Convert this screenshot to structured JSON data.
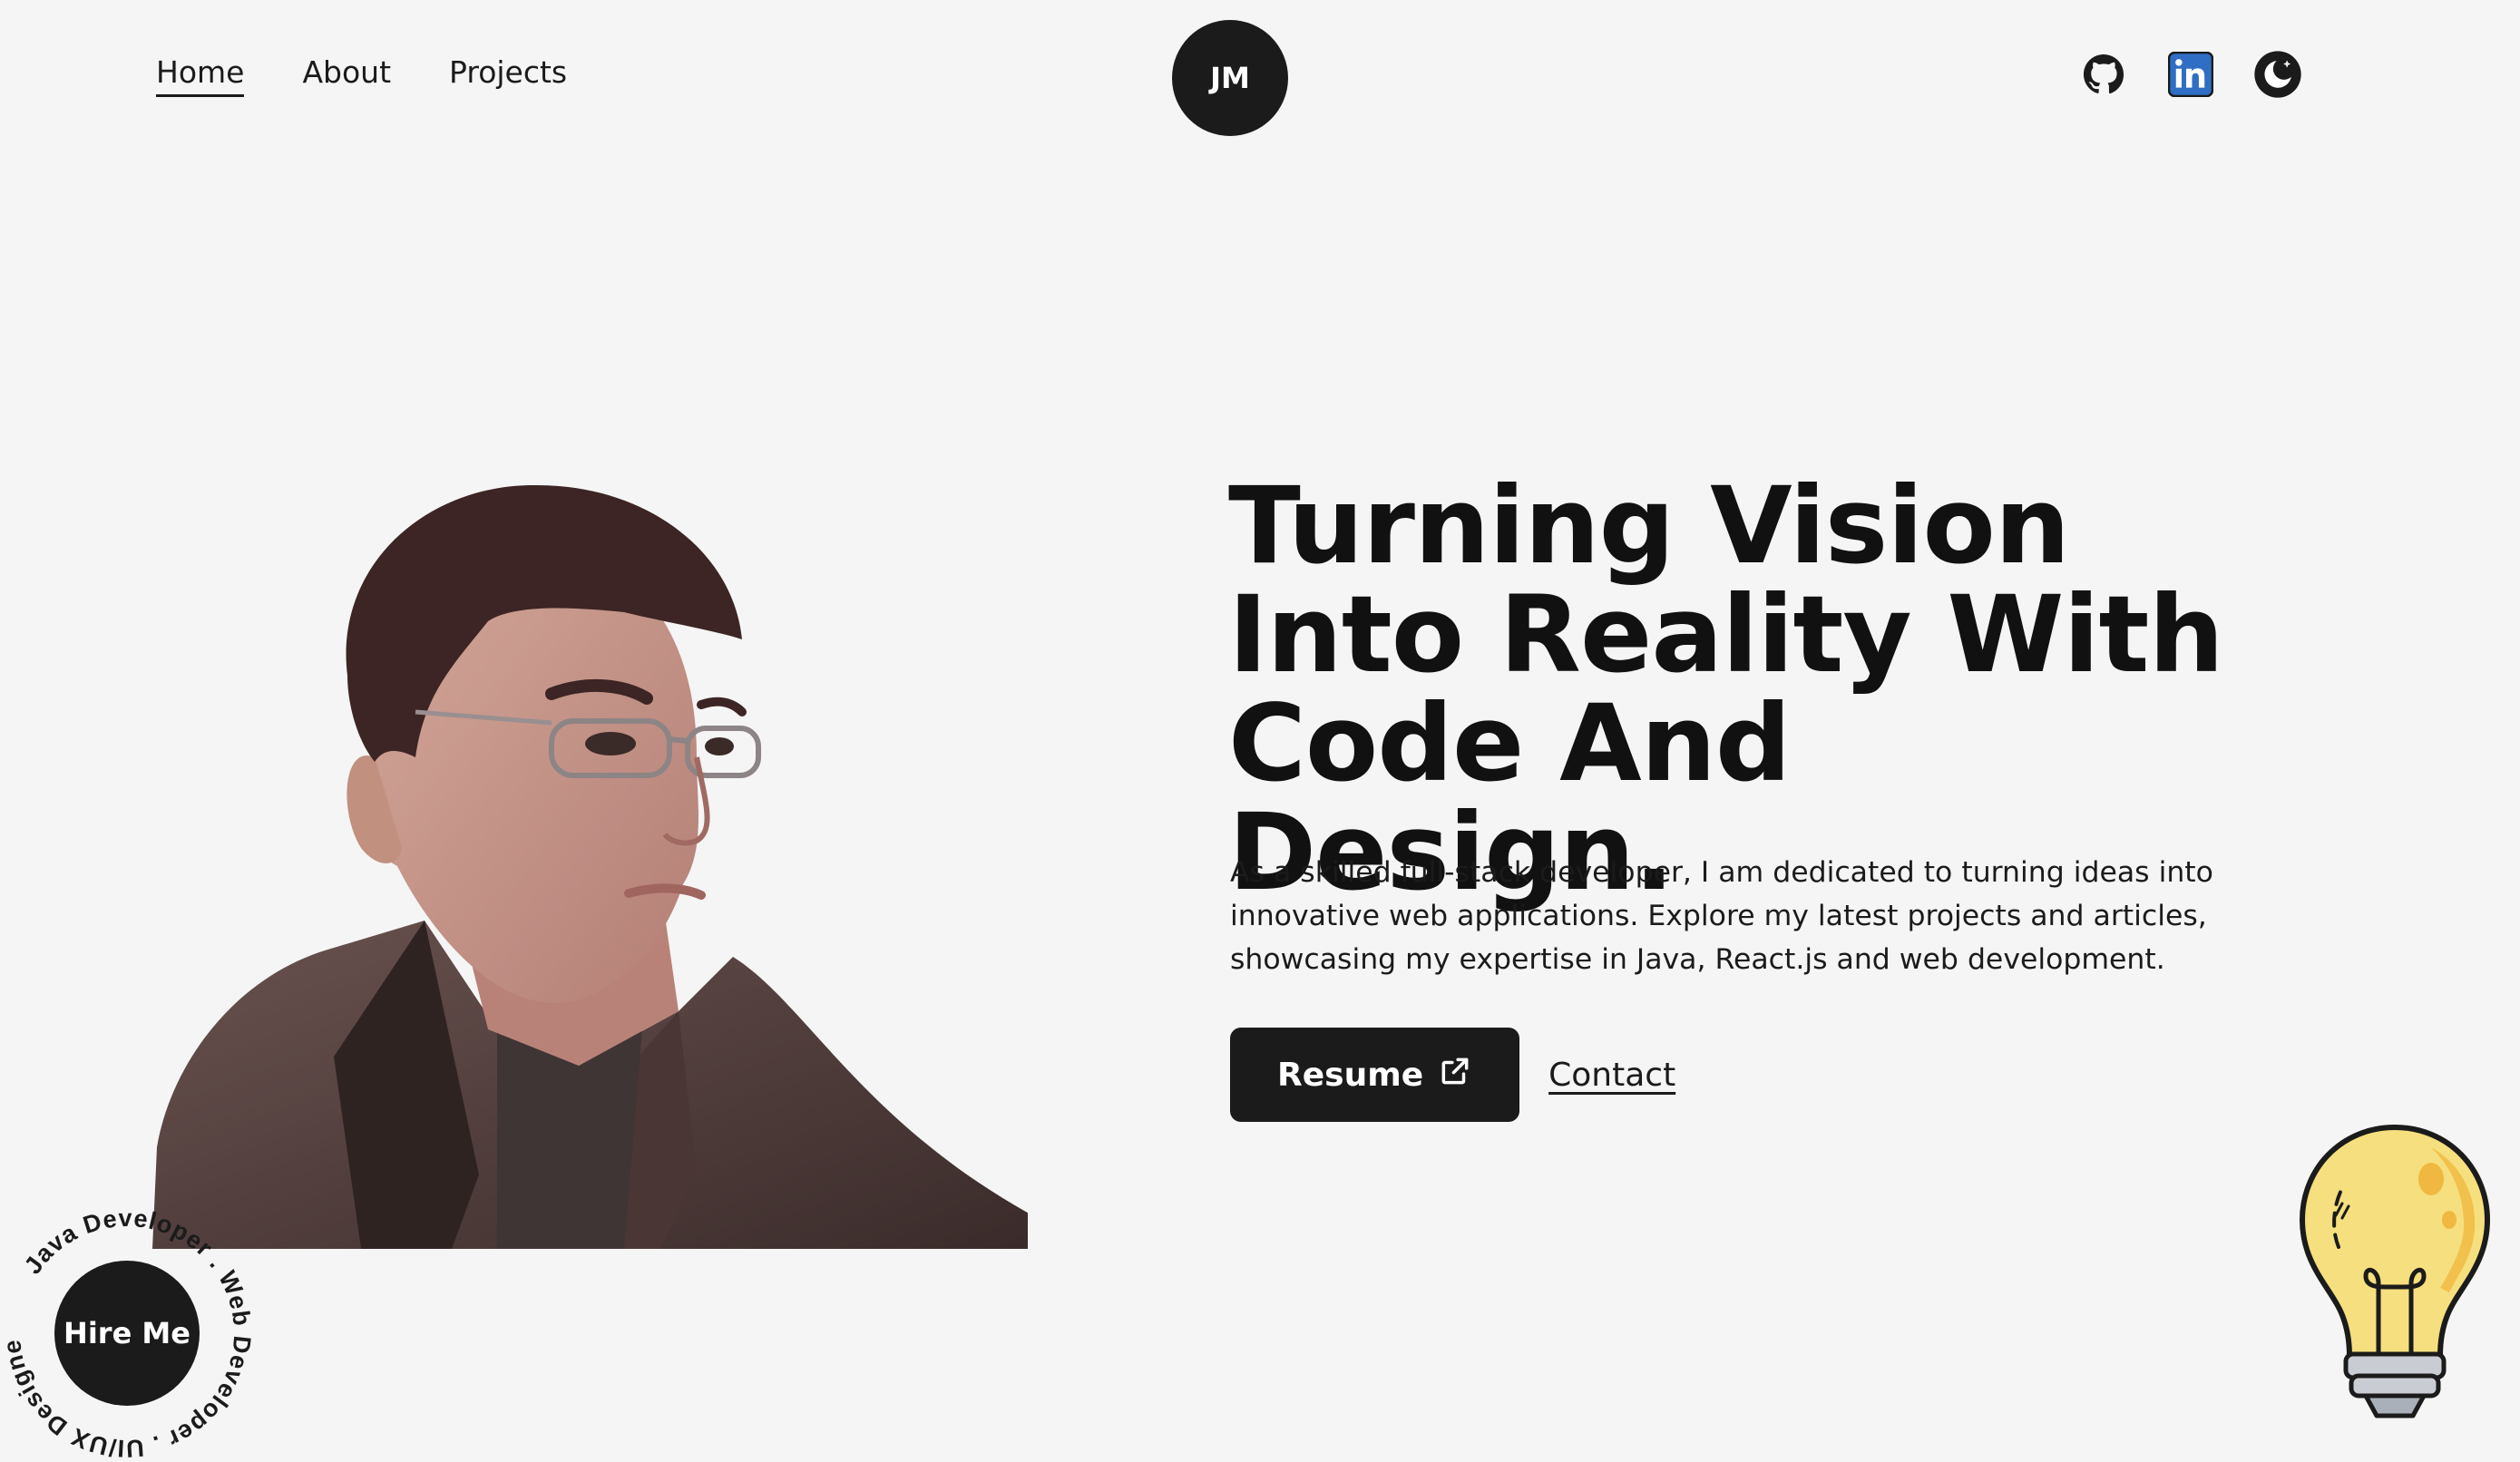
{
  "nav": {
    "links": [
      {
        "label": "Home",
        "active": true
      },
      {
        "label": "About",
        "active": false
      },
      {
        "label": "Projects",
        "active": false
      }
    ],
    "logo": "JM",
    "social": [
      {
        "icon": "github-icon"
      },
      {
        "icon": "linkedin-icon"
      },
      {
        "icon": "moon-icon"
      }
    ]
  },
  "hero": {
    "headline": "Turning Vision Into Reality With Code And Design.",
    "intro": "As a skilled full-stack developer, I am dedicated to turning ideas into innovative web applications. Explore my latest projects and articles, showcasing my expertise in Java, React.js and web development.",
    "resume_label": "Resume",
    "contact_label": "Contact"
  },
  "hire": {
    "label": "Hire Me",
    "ring_text": "Java Developer . Web Developer . UI/UX Designer ."
  },
  "colors": {
    "background": "#f5f5f5",
    "dark": "#1b1b1b",
    "linkedin": "#2f6ec4",
    "bulb": "#f6df7e"
  }
}
